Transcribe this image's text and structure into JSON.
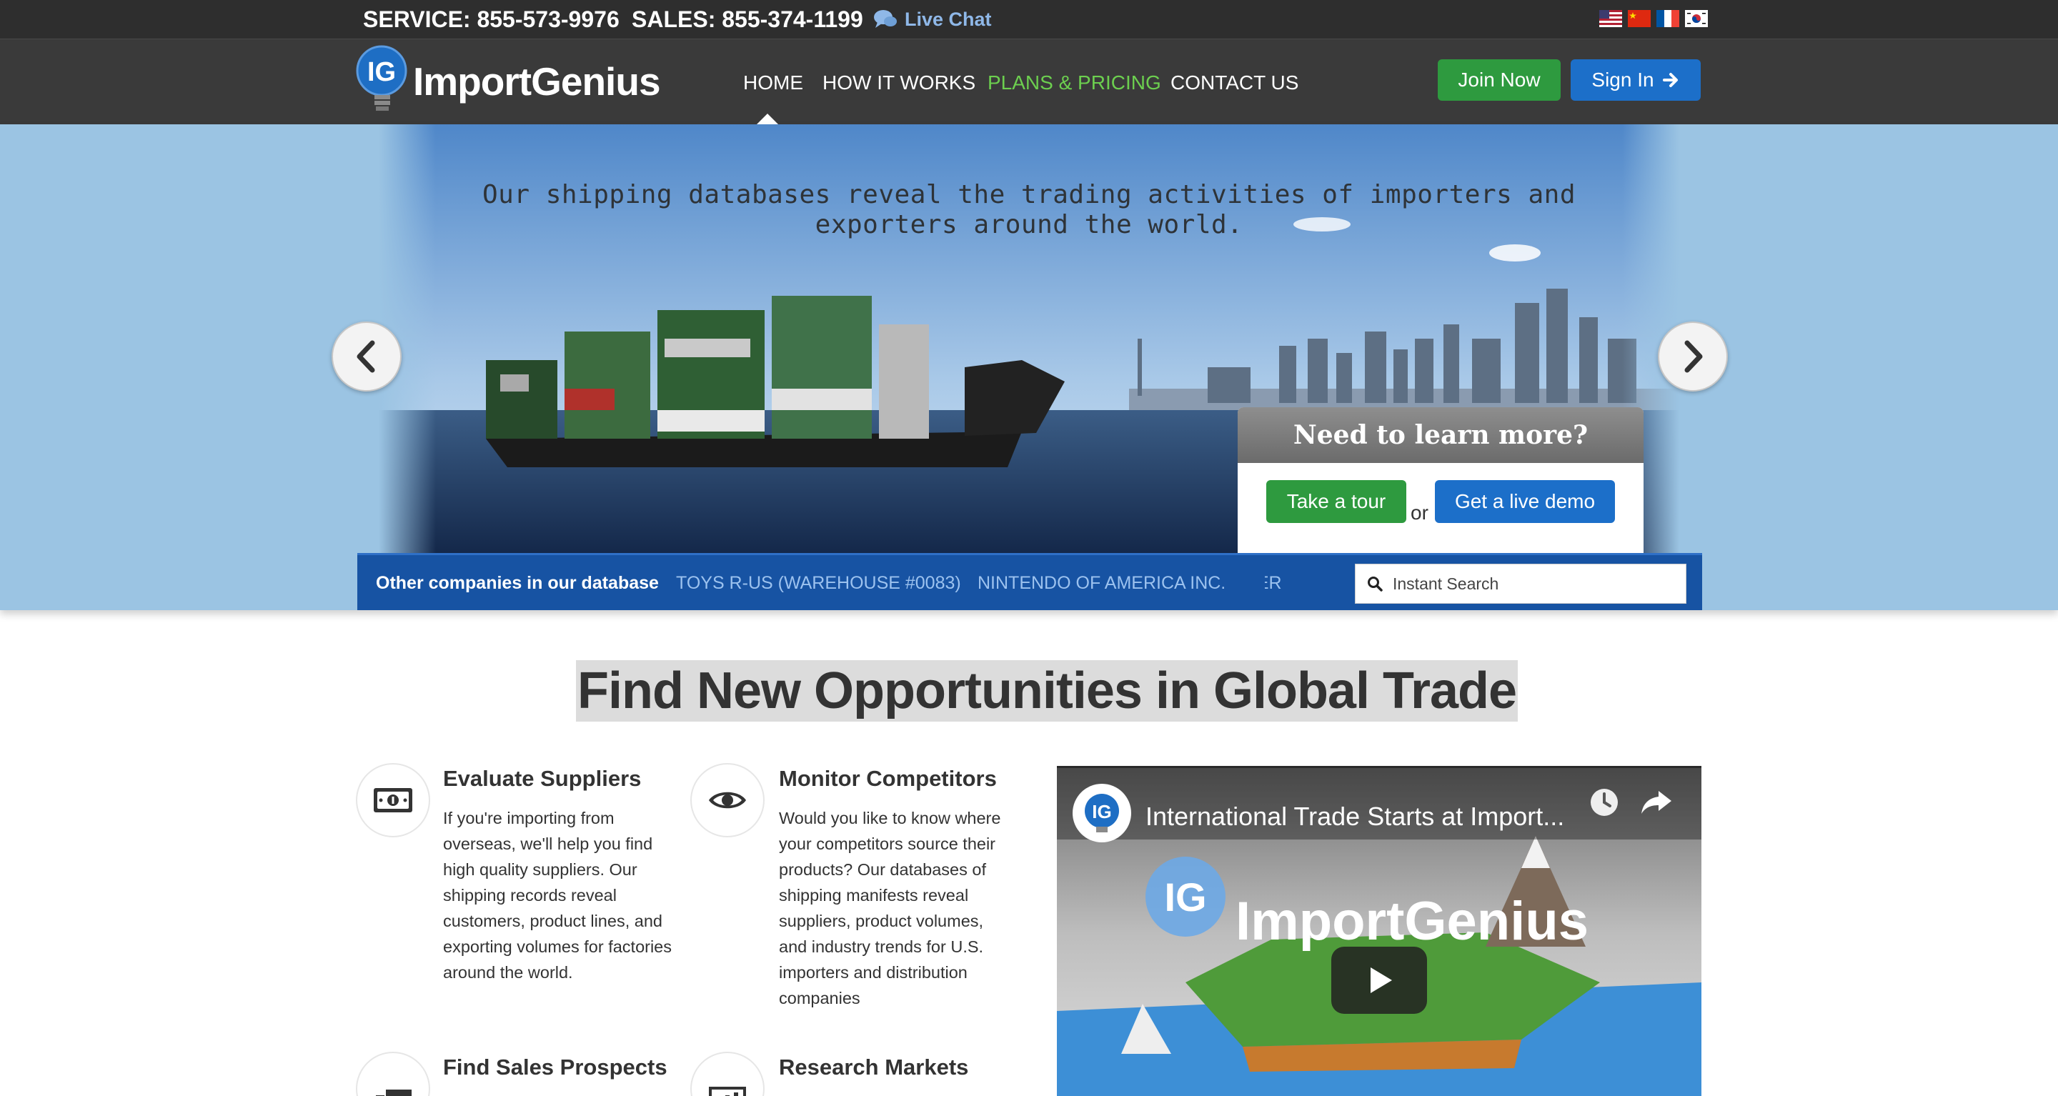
{
  "topbar": {
    "service_phone": "SERVICE: 855-573-9976",
    "sales_phone": "SALES: 855-374-1199",
    "live_chat": "Live Chat",
    "flags": [
      "us-flag",
      "china-flag",
      "france-flag",
      "korea-flag"
    ]
  },
  "nav": {
    "logo_letters": "IG",
    "logo_text": "ImportGenius",
    "links": [
      "HOME",
      "HOW IT WORKS",
      "PLANS & PRICING",
      "CONTACT US"
    ],
    "join_label": "Join Now",
    "signin_label": "Sign In"
  },
  "hero": {
    "tagline": "Our shipping databases reveal the trading activities of importers and exporters around the world.",
    "learn_more_title": "Need to learn more?",
    "tour_label": "Take a tour",
    "or_text": "or",
    "demo_label": "Get a live demo"
  },
  "ticker": {
    "title": "Other companies in our database",
    "companies": [
      "TOYS R-US (WAREHOUSE #0083)",
      "NINTENDO OF AMERICA INC.",
      "SHIN CATER"
    ],
    "search_placeholder": "Instant Search"
  },
  "main": {
    "headline": "Find New Opportunities in Global Trade",
    "features": [
      {
        "title": "Evaluate Suppliers",
        "icon": "money-icon",
        "body": [
          "If you're importing from",
          "overseas, we'll help you find",
          "high quality suppliers. Our",
          "shipping records reveal",
          "customers, product lines, and",
          "exporting volumes for factories",
          "around the world."
        ]
      },
      {
        "title": "Monitor Competitors",
        "icon": "eye-icon",
        "body": [
          "Would you like to know where",
          "your competitors source their",
          "products? Our databases of",
          "shipping manifests reveal",
          "suppliers, product volumes,",
          "and industry trends for U.S.",
          "importers and distribution",
          "companies"
        ]
      },
      {
        "title": "Find Sales Prospects",
        "icon": "truck-icon"
      },
      {
        "title": "Research Markets",
        "icon": "bar-chart-icon"
      }
    ]
  },
  "video": {
    "title": "International Trade Starts at Import...",
    "logo_letters": "IG",
    "brand_text": "ImportGenius"
  },
  "colors": {
    "topbar_bg": "#2e2e2e",
    "nav_bg": "#3a3a3a",
    "accent_green": "#2e9a3f",
    "accent_blue": "#1c6fc9",
    "hero_bg": "#9bc4e3",
    "ticker_bg": "#1753a3"
  }
}
